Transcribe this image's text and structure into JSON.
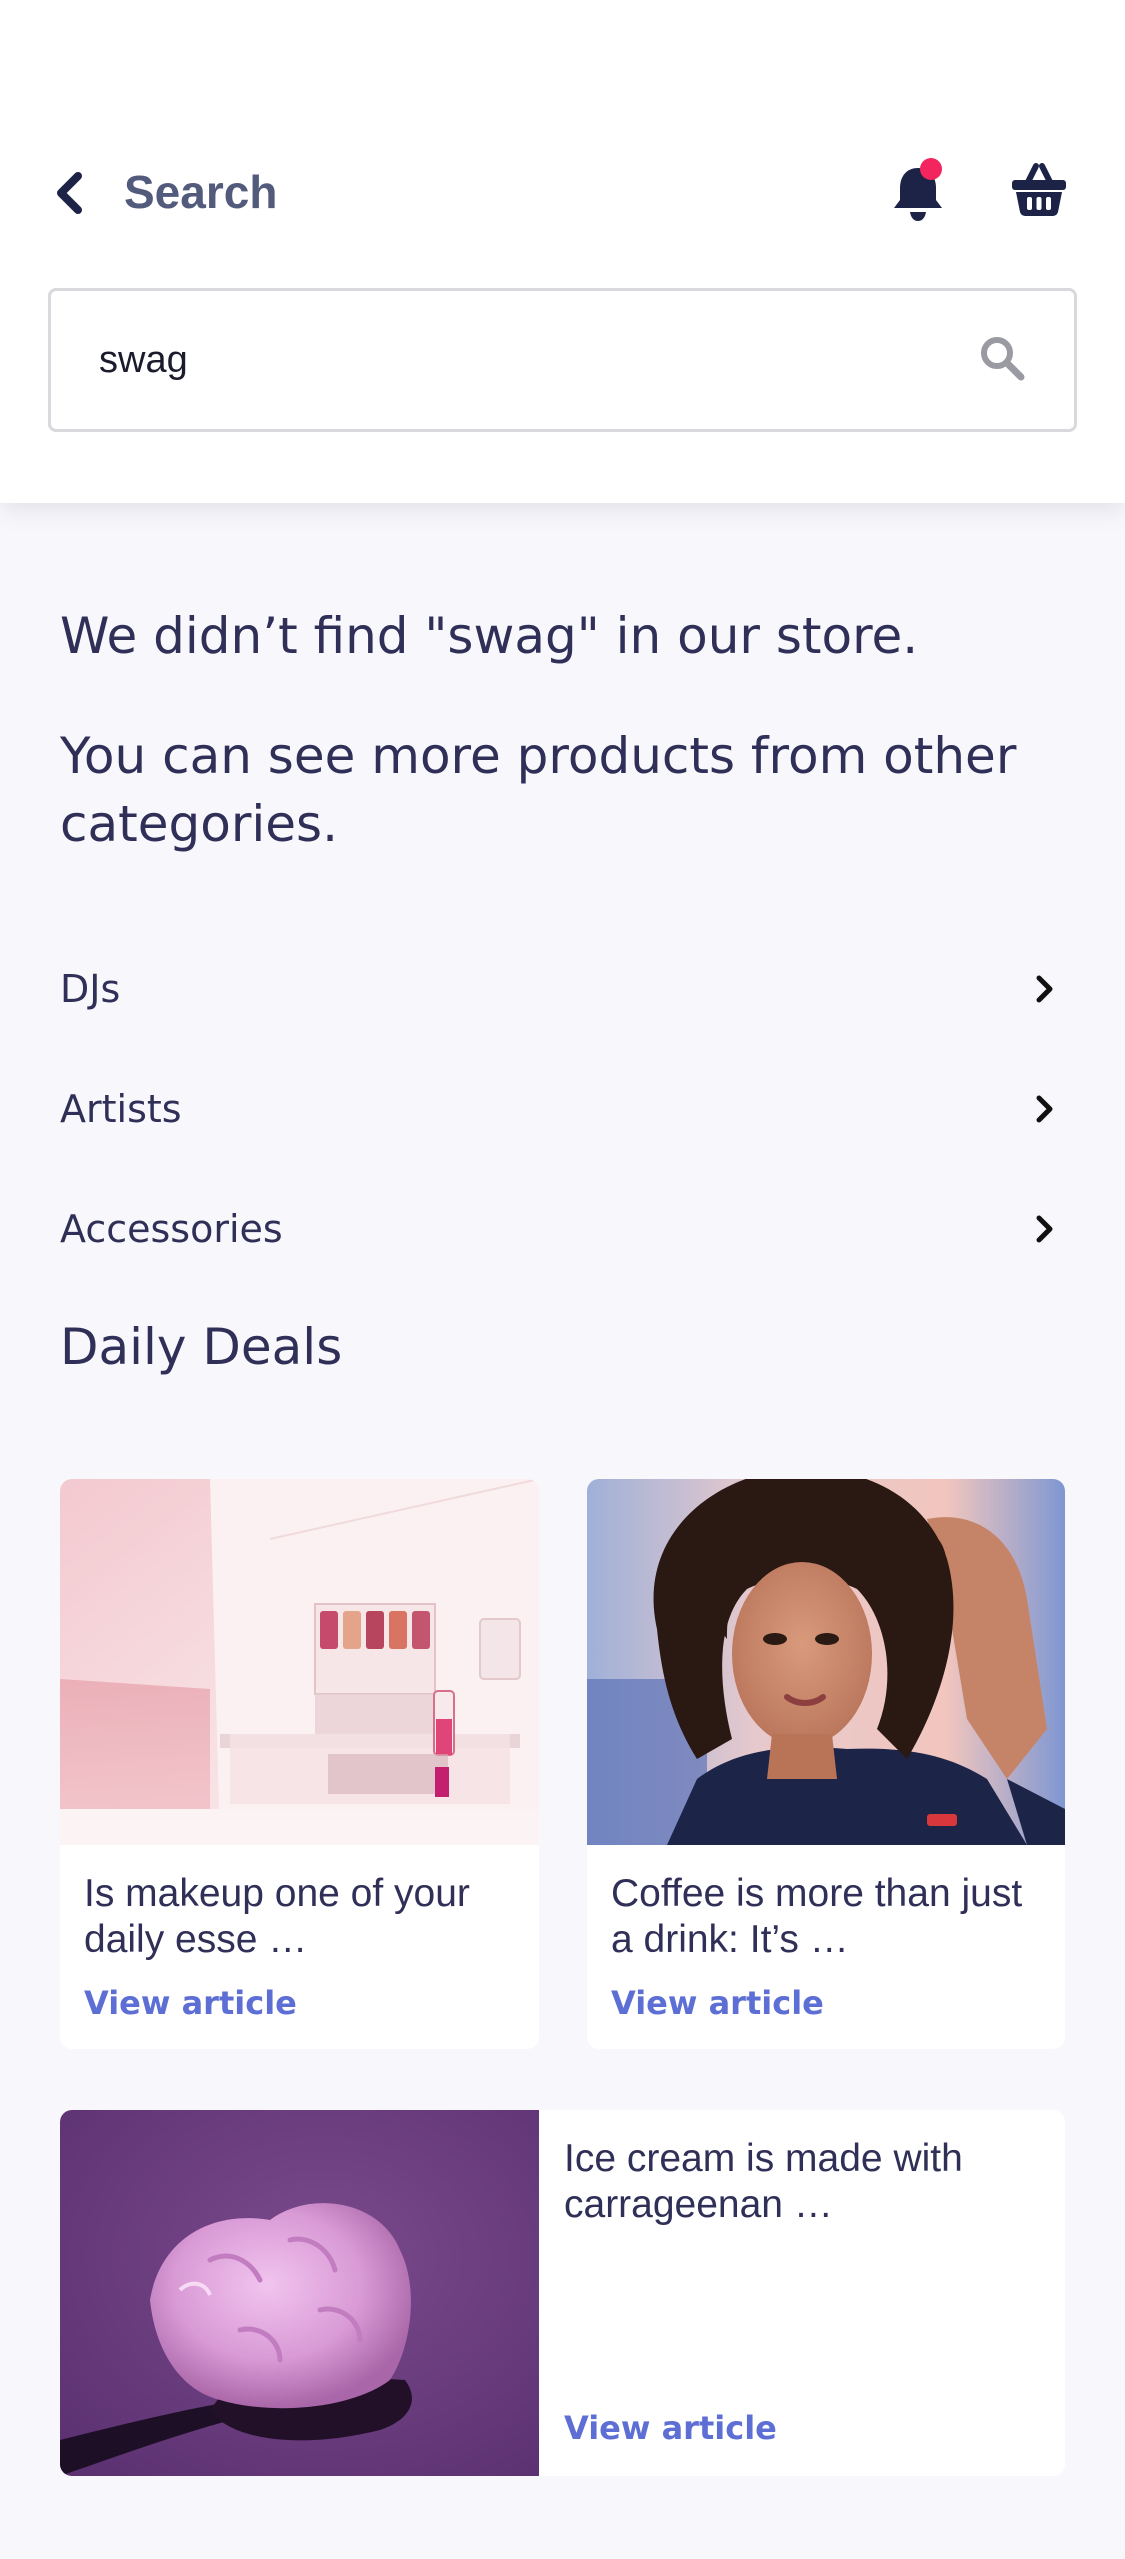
{
  "header": {
    "title": "Search",
    "back_icon": "chevron-left-icon",
    "notification_icon": "bell-icon",
    "notification_badge_color": "#f2255f",
    "cart_icon": "basket-icon"
  },
  "search": {
    "value": "swag",
    "placeholder": "",
    "icon": "search-icon"
  },
  "message": {
    "not_found": "We didn’t find \"swag\" in our store.",
    "suggestion": "You can see more products from other categories."
  },
  "categories": [
    {
      "label": "DJs"
    },
    {
      "label": "Artists"
    },
    {
      "label": "Accessories"
    }
  ],
  "daily_deals": {
    "title": "Daily Deals",
    "articles": [
      {
        "excerpt": "Is makeup one of your daily esse …",
        "link_label": "View article",
        "image": "makeup-shelf-photo"
      },
      {
        "excerpt": "Coffee is more than just a drink: It’s …",
        "link_label": "View article",
        "image": "curly-hair-woman-portrait"
      },
      {
        "excerpt": "Ice cream is made with carrageenan …",
        "link_label": "View article",
        "image": "ice-cream-spoon-photo"
      }
    ]
  },
  "colors": {
    "accent_link": "#5d6ed4",
    "text_primary": "#2f2f58",
    "header_title": "#525b7c",
    "background": "#f8f8fc"
  }
}
